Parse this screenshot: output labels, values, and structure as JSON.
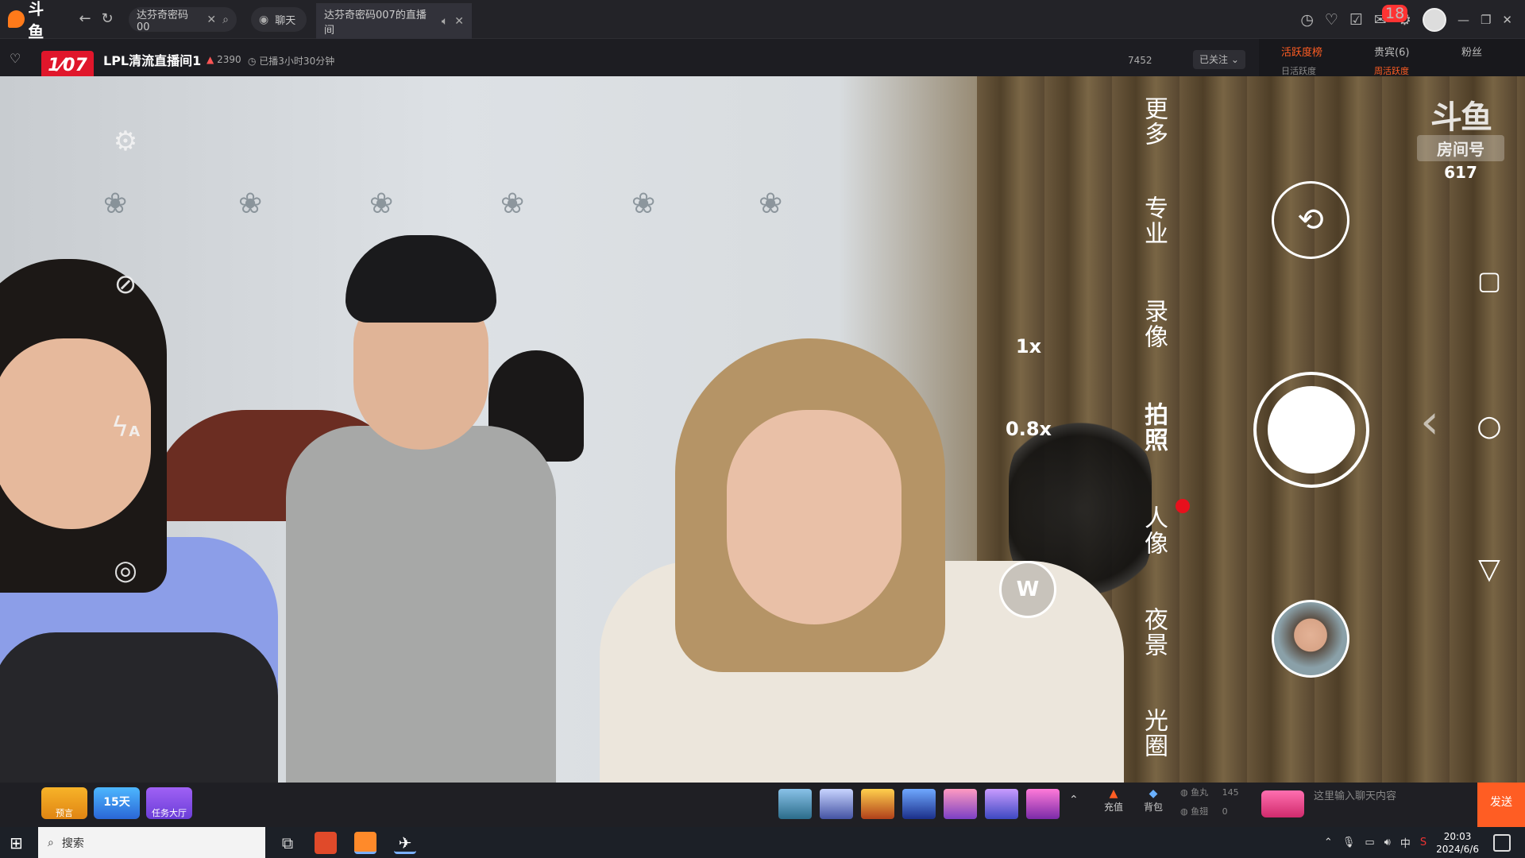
{
  "browser": {
    "logo_text": "斗鱼",
    "tabs": [
      {
        "label": "达芬奇密码00"
      },
      {
        "label": "聊天"
      },
      {
        "label": "达芬奇密码007的直播间"
      }
    ],
    "notification_count": "18"
  },
  "room": {
    "logo_text": "1⁄07",
    "title": "LPL清流直播间1",
    "heat": "2390",
    "live_time": "已播3小时30分钟",
    "followers": "7452",
    "follow_label": "已关注",
    "rank_tabs": [
      "活跃度榜",
      "贵宾(6)",
      "粉丝"
    ],
    "rank_sub": [
      "日活跃度",
      "周活跃度"
    ]
  },
  "camera": {
    "zoom_1x": "1x",
    "zoom_08x": "0.8x",
    "wide": "W",
    "modes": [
      "更多",
      "专业",
      "录像",
      "拍照",
      "人像",
      "夜景",
      "光圈"
    ],
    "active_mode": "拍照",
    "flash_label": "A"
  },
  "watermark": {
    "logo": "斗鱼",
    "label": "房间号",
    "room_number": "617"
  },
  "bottom": {
    "actions": [
      "预言",
      "15天",
      "任务大厅"
    ],
    "recharge": "充值",
    "backpack": "背包",
    "fish_ball_label": "鱼丸",
    "fish_ball_value": "145",
    "fish_wing_label": "鱼翅",
    "fish_wing_value": "0",
    "chat_placeholder": "这里输入聊天内容",
    "send": "发送"
  },
  "taskbar": {
    "search": "搜索",
    "ime": "中",
    "time": "20:03",
    "date": "2024/6/6"
  },
  "colors": {
    "accent": "#ff5d23",
    "brand_red": "#e0162b",
    "record_dot": "#e8101c"
  }
}
